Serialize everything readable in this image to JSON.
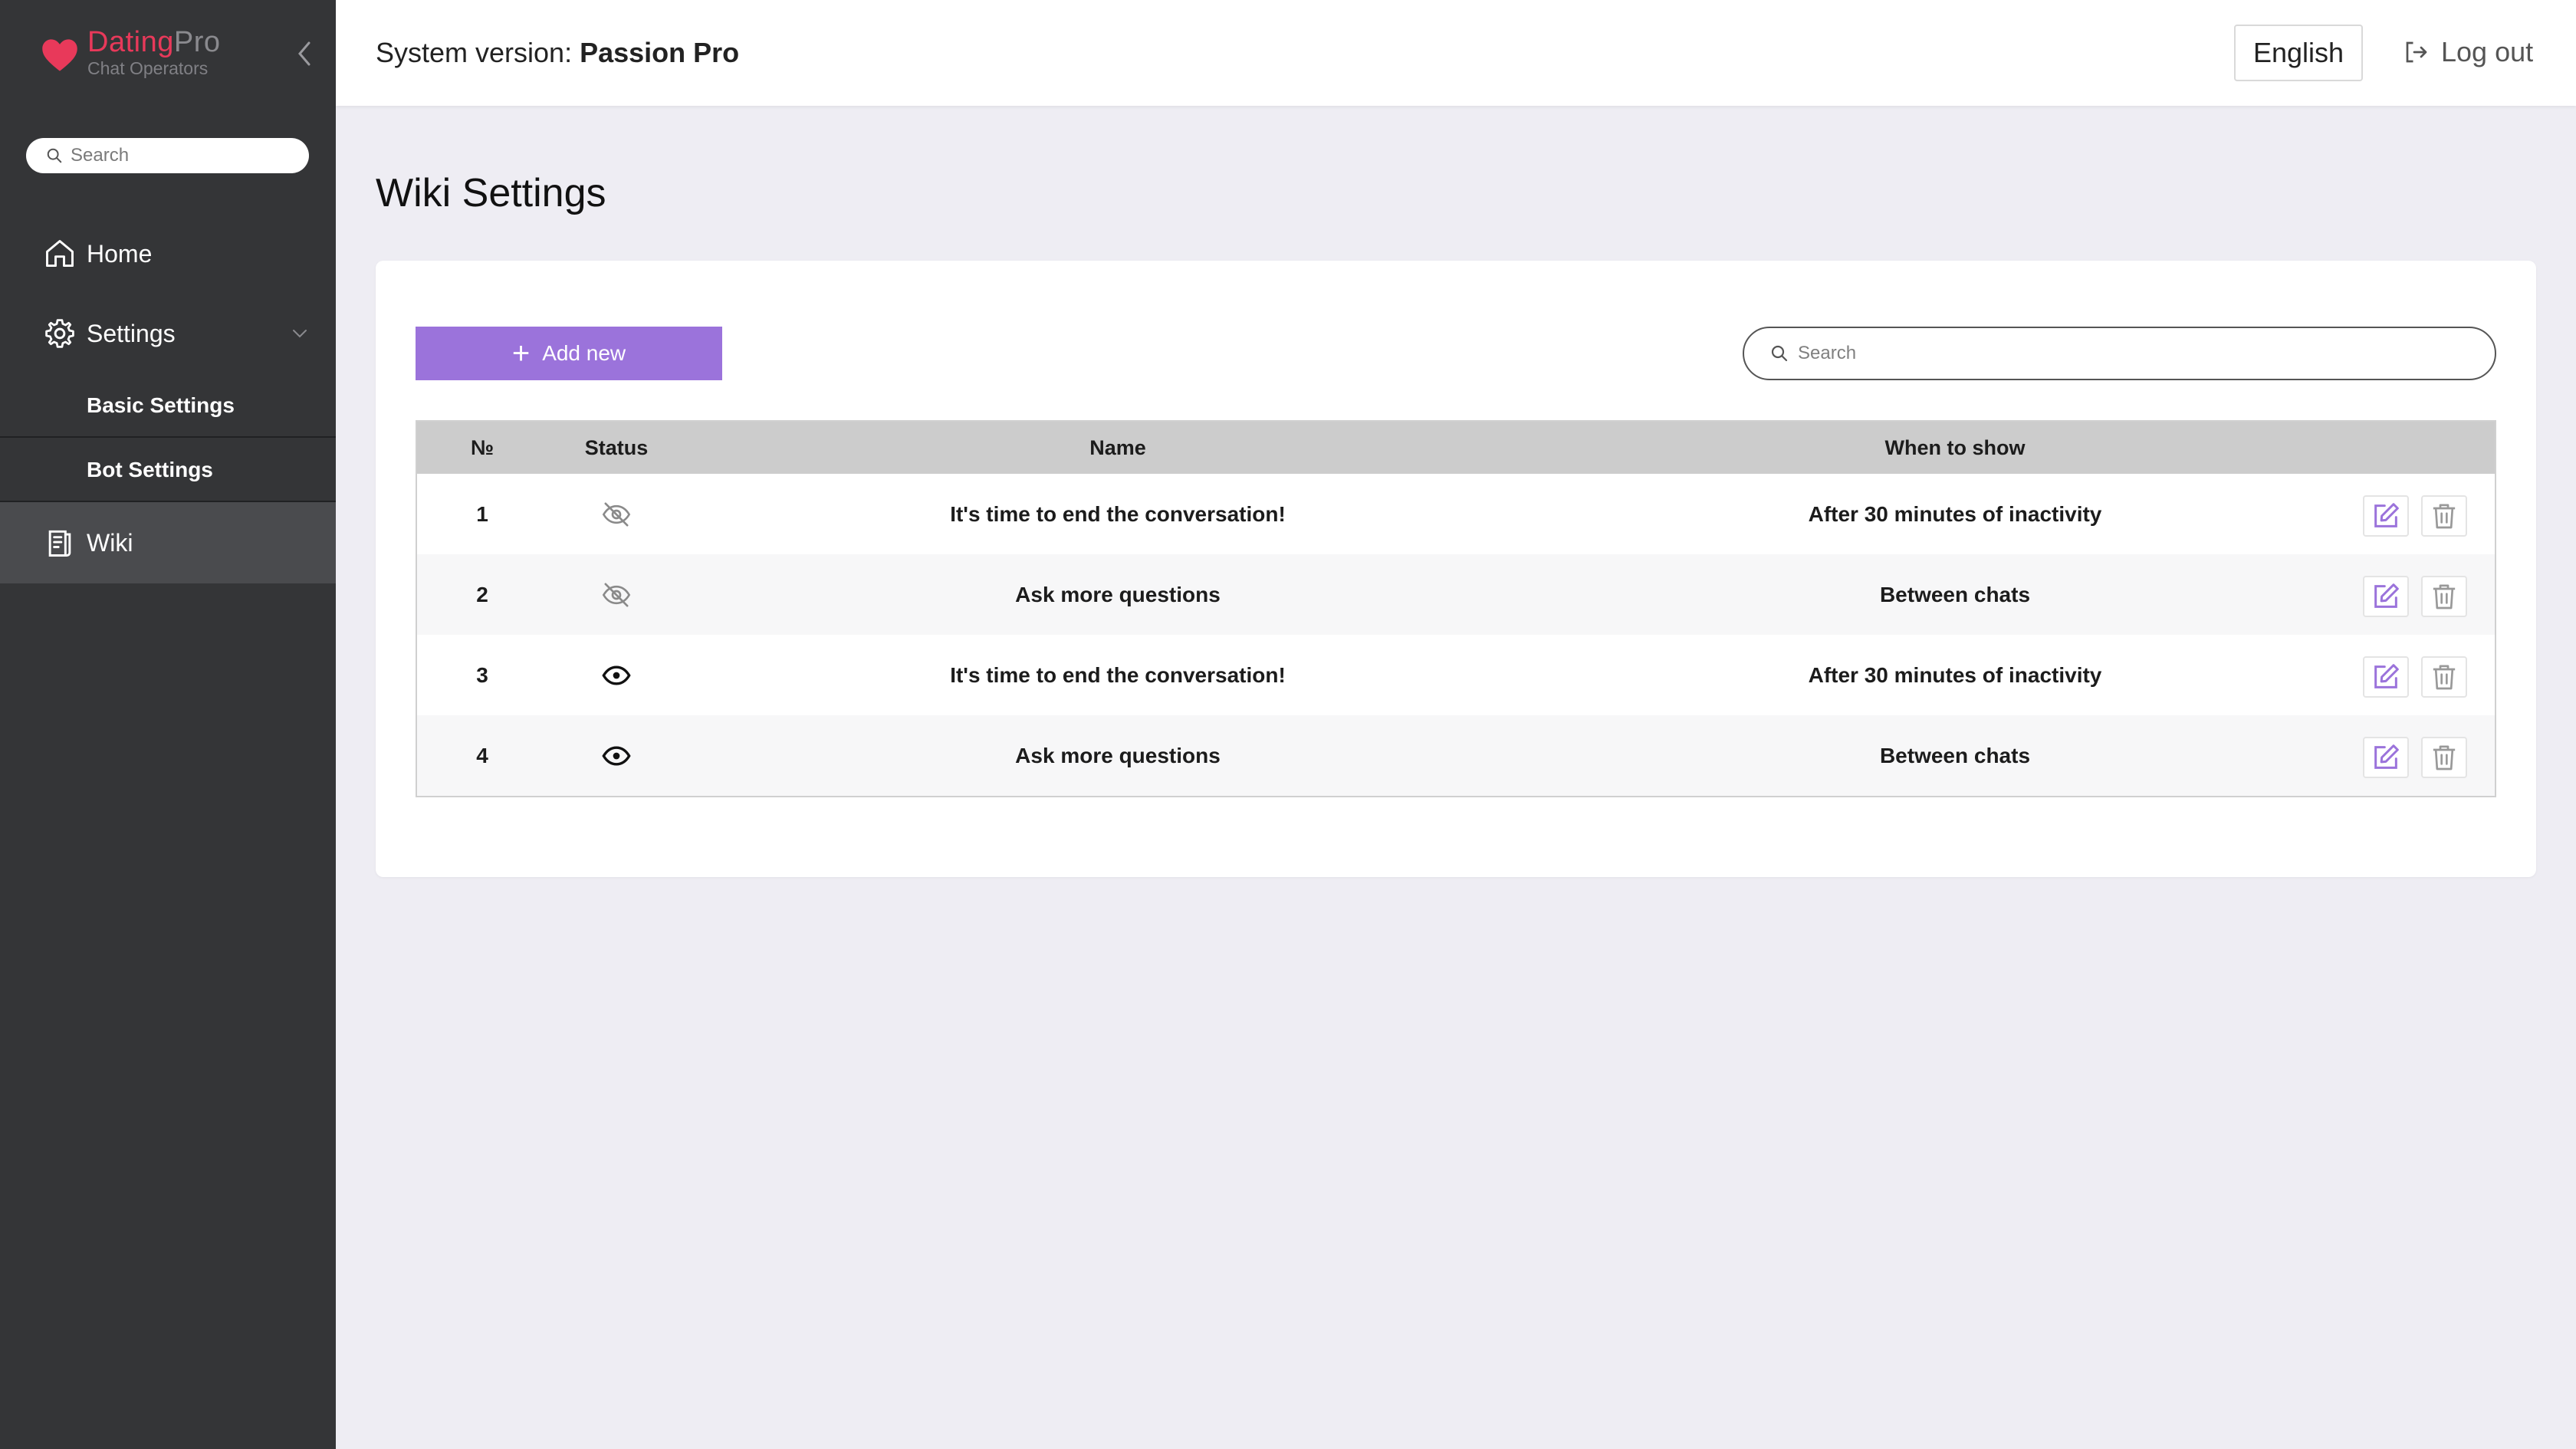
{
  "brand": {
    "name_part1": "Dating",
    "name_part2": "Pro",
    "subtitle": "Chat Operators",
    "accent": "#e8395a"
  },
  "sidebar": {
    "search_placeholder": "Search",
    "items": [
      {
        "label": "Home",
        "icon": "home-icon"
      },
      {
        "label": "Settings",
        "icon": "gear-icon",
        "expanded": true,
        "children": [
          {
            "label": "Basic Settings"
          },
          {
            "label": "Bot Settings"
          }
        ]
      },
      {
        "label": "Wiki",
        "icon": "wiki-icon",
        "active": true
      }
    ]
  },
  "header": {
    "system_version_label": "System version:",
    "system_version_value": "Passion Pro",
    "language": "English",
    "logout_label": "Log out"
  },
  "page": {
    "title": "Wiki Settings",
    "add_button_label": "Add new",
    "search_placeholder": "Search",
    "accent": "#9b73db"
  },
  "table": {
    "columns": [
      "№",
      "Status",
      "Name",
      "When to show"
    ],
    "rows": [
      {
        "num": "1",
        "status": "hidden",
        "status_icon": "eye-off-icon",
        "name": "It's time to end the conversation!",
        "when": "After 30 minutes of inactivity"
      },
      {
        "num": "2",
        "status": "hidden",
        "status_icon": "eye-off-icon",
        "name": "Ask more questions",
        "when": "Between chats"
      },
      {
        "num": "3",
        "status": "visible",
        "status_icon": "eye-icon",
        "name": "It's time to end the conversation!",
        "when": "After 30 minutes of inactivity"
      },
      {
        "num": "4",
        "status": "visible",
        "status_icon": "eye-icon",
        "name": "Ask more questions",
        "when": "Between chats"
      }
    ]
  }
}
